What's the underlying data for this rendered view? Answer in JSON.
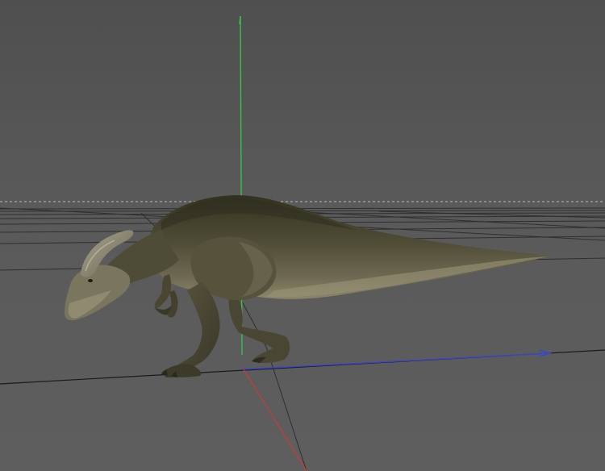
{
  "viewport": {
    "view": "perspective-3d",
    "background_top": "#515151",
    "background_bottom": "#5e5e5e",
    "grid_color": "#2e2e2e",
    "horizon_color": "#c8c8c8",
    "axes": {
      "x": {
        "color": "#3a46c8",
        "arrow": true
      },
      "y": {
        "color": "#3dbf4a"
      },
      "z": {
        "color": "#c83a3a"
      }
    },
    "model": {
      "name": "parasaurolophus",
      "pose": "walking",
      "colors": {
        "back": "#3c3a2a",
        "flank": "#5a5740",
        "belly": "#8a8468",
        "crest": "#9a9682"
      }
    }
  }
}
